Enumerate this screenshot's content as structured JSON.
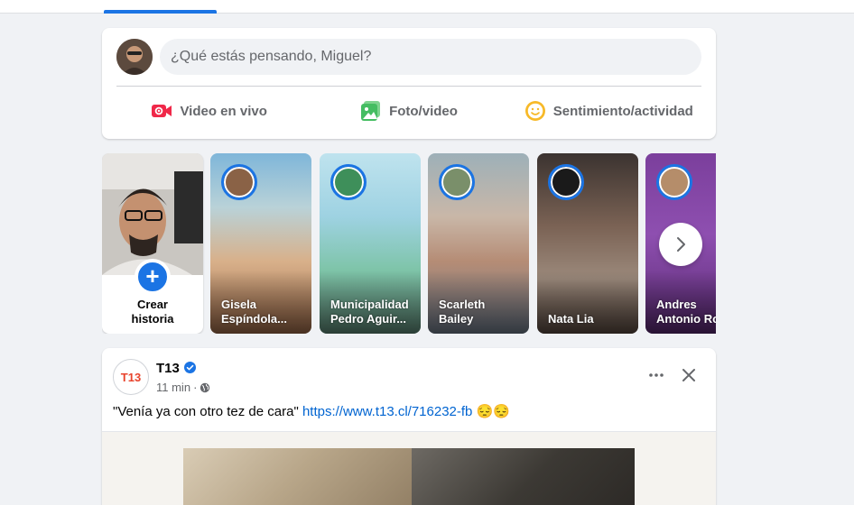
{
  "composer": {
    "placeholder": "¿Qué estás pensando, Miguel?",
    "actions": [
      {
        "label": "Video en vivo",
        "icon": "live-video-icon",
        "color": "#f02849"
      },
      {
        "label": "Foto/video",
        "icon": "photo-icon",
        "color": "#45bd62"
      },
      {
        "label": "Sentimiento/actividad",
        "icon": "feeling-icon",
        "color": "#f7b928"
      }
    ]
  },
  "stories": {
    "create_label": "Crear\nhistoria",
    "items": [
      {
        "name": "Gisela\nEspíndola..."
      },
      {
        "name": "Municipalidad\nPedro Aguir..."
      },
      {
        "name": "Scarleth\nBailey"
      },
      {
        "name": "Nata Lia"
      },
      {
        "name": "Andres\nAntonio Ro"
      }
    ]
  },
  "post": {
    "page_name": "T13",
    "logo_text": "T13",
    "time": "11 min",
    "separator": "·",
    "text_prefix": "\"Venía ya con otro tez de cara\" ",
    "link": "https://www.t13.cl/716232-fb",
    "emoji": "😔😔"
  },
  "colors": {
    "accent": "#1b74e4",
    "link": "#0064d1",
    "t13_red": "#e8432c"
  }
}
